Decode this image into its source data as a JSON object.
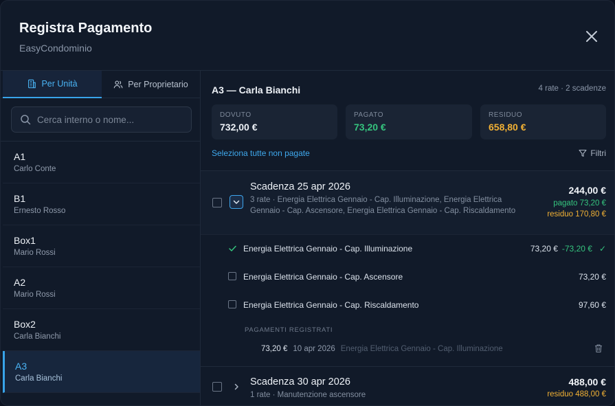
{
  "header": {
    "title": "Registra Pagamento",
    "subtitle": "EasyCondominio"
  },
  "tabs": [
    {
      "label": "Per Unità"
    },
    {
      "label": "Per Proprietario"
    }
  ],
  "search": {
    "placeholder": "Cerca interno o nome..."
  },
  "units": [
    {
      "code": "A1",
      "owner": "Carlo Conte"
    },
    {
      "code": "B1",
      "owner": "Ernesto Rosso"
    },
    {
      "code": "Box1",
      "owner": "Mario Rossi"
    },
    {
      "code": "A2",
      "owner": "Mario Rossi"
    },
    {
      "code": "Box2",
      "owner": "Carla Bianchi"
    },
    {
      "code": "A3",
      "owner": "Carla Bianchi"
    }
  ],
  "detail": {
    "title": "A3 — Carla Bianchi",
    "meta": "4 rate · 2 scadenze",
    "stats": {
      "dovuto": {
        "label": "DOVUTO",
        "value": "732,00 €"
      },
      "pagato": {
        "label": "PAGATO",
        "value": "73,20 €"
      },
      "residuo": {
        "label": "RESIDUO",
        "value": "658,80 €"
      }
    },
    "select_all": "Seleziona tutte non pagate",
    "filters": "Filtri",
    "due1": {
      "title": "Scadenza 25 apr 2026",
      "desc": "3 rate · Energia Elettrica Gennaio - Cap. Illuminazione, Energia Elettrica Gennaio - Cap. Ascensore, Energia Elettrica Gennaio - Cap. Riscaldamento",
      "amount": "244,00 €",
      "paid": "pagato 73,20 €",
      "residual": "residuo 170,80 €",
      "rates": [
        {
          "name": "Energia Elettrica Gennaio - Cap. Illuminazione",
          "amount": "73,20 €",
          "paid": "-73,20 €"
        },
        {
          "name": "Energia Elettrica Gennaio - Cap. Ascensore",
          "amount": "73,20 €"
        },
        {
          "name": "Energia Elettrica Gennaio - Cap. Riscaldamento",
          "amount": "97,60 €"
        }
      ],
      "payments_header": "PAGAMENTI REGISTRATI",
      "payment": {
        "amount": "73,20 €",
        "date": "10 apr 2026",
        "ref": "Energia Elettrica Gennaio - Cap. Illuminazione"
      }
    },
    "due2": {
      "title": "Scadenza 30 apr 2026",
      "desc": "1 rate · Manutenzione ascensore",
      "amount": "488,00 €",
      "residual": "residuo 488,00 €"
    }
  },
  "colors": {
    "accent": "#3ea6ed",
    "paid": "#35c47e",
    "residual": "#f2b134"
  },
  "icons": [
    "close-icon",
    "building-icon",
    "users-icon",
    "search-icon",
    "chevron-down-icon",
    "filter-icon",
    "check-icon",
    "trash-icon",
    "chevron-right-icon"
  ]
}
